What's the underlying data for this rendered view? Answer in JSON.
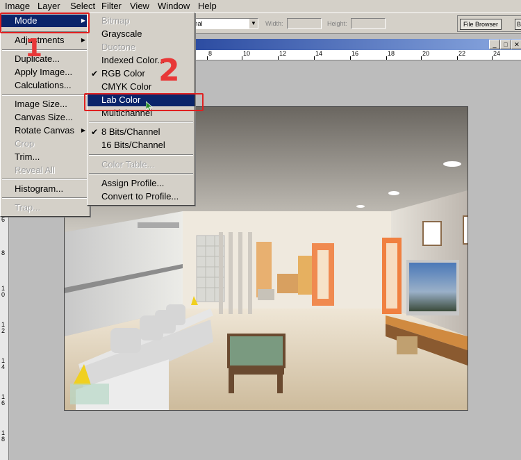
{
  "menubar": {
    "items": [
      {
        "label": "Image"
      },
      {
        "label": "Layer"
      },
      {
        "label": "Select"
      },
      {
        "label": "Filter"
      },
      {
        "label": "View"
      },
      {
        "label": "Window"
      },
      {
        "label": "Help"
      }
    ]
  },
  "options": {
    "style_value": "rmal",
    "width_label": "Width:",
    "height_label": "Height:",
    "file_browser_tab": "File Browser",
    "tab_b": "B"
  },
  "image_menu": {
    "items": [
      {
        "label": "Mode",
        "highlighted": true,
        "submenu": true
      },
      {
        "label": "Adjustments",
        "submenu": true
      },
      {
        "label": "Duplicate..."
      },
      {
        "label": "Apply Image..."
      },
      {
        "label": "Calculations..."
      },
      {
        "label": "Image Size..."
      },
      {
        "label": "Canvas Size..."
      },
      {
        "label": "Rotate Canvas",
        "submenu": true
      },
      {
        "label": "Crop",
        "disabled": true
      },
      {
        "label": "Trim..."
      },
      {
        "label": "Reveal All",
        "disabled": true
      },
      {
        "label": "Histogram..."
      },
      {
        "label": "Trap...",
        "disabled": true
      }
    ]
  },
  "mode_submenu": {
    "items": [
      {
        "label": "Bitmap",
        "disabled": true
      },
      {
        "label": "Grayscale"
      },
      {
        "label": "Duotone",
        "disabled": true
      },
      {
        "label": "Indexed Color..."
      },
      {
        "label": "RGB Color",
        "checked": true
      },
      {
        "label": "CMYK Color"
      },
      {
        "label": "Lab Color",
        "highlighted": true
      },
      {
        "label": "Multichannel"
      },
      {
        "label": "8 Bits/Channel",
        "checked": true
      },
      {
        "label": "16 Bits/Channel"
      },
      {
        "label": "Color Table...",
        "disabled": true
      },
      {
        "label": "Assign Profile..."
      },
      {
        "label": "Convert to Profile..."
      }
    ]
  },
  "annotations": {
    "step1": "1",
    "step2": "2",
    "color": "#e83838"
  },
  "ruler": {
    "h_labels": [
      "8",
      "10",
      "12",
      "14",
      "16",
      "18",
      "20",
      "22",
      "24"
    ],
    "v_labels": [
      "6",
      "8",
      "1 0",
      "1 2",
      "1 4",
      "1 6",
      "1 8"
    ]
  },
  "colors": {
    "menu_bg": "#d4d0c8",
    "highlight": "#0a246a",
    "titlebar_start": "#2a4aa0",
    "titlebar_end": "#8aa8e0"
  }
}
